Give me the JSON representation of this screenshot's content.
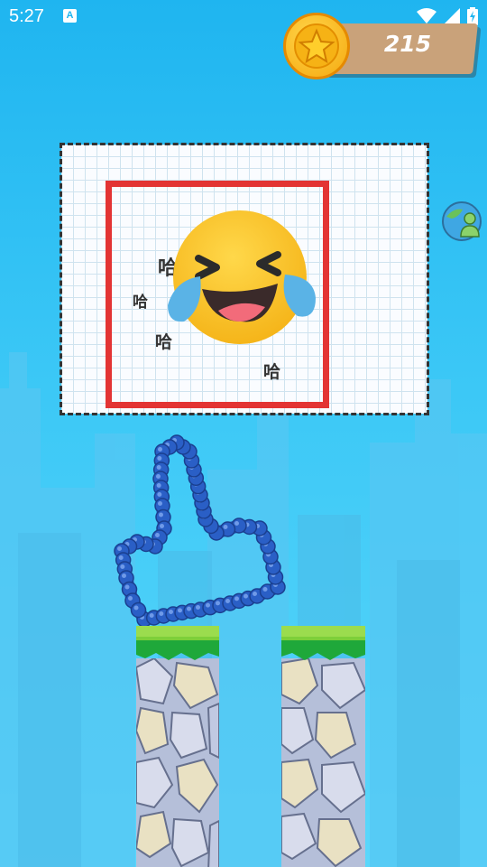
{
  "status_bar": {
    "time": "5:27",
    "notification_icon": "a-letter-icon",
    "icons": [
      "wifi-icon",
      "signal-icon",
      "battery-charging-icon"
    ]
  },
  "hud": {
    "coins": "215",
    "coin_icon": "star-coin-icon"
  },
  "puzzle": {
    "laughs": [
      "哈",
      "哈",
      "哈",
      "哈"
    ],
    "emoji": "laughing-crying-emoji",
    "frame_color": "#e33434"
  },
  "drawing": {
    "shape": "thumbs-up",
    "color": "#2a5fc6"
  },
  "side_buttons": {
    "share_icon": "earth-person-icon"
  },
  "colors": {
    "sky": "#1fb5f0",
    "grass": "#7dcf3a",
    "coin": "#f6b215"
  }
}
